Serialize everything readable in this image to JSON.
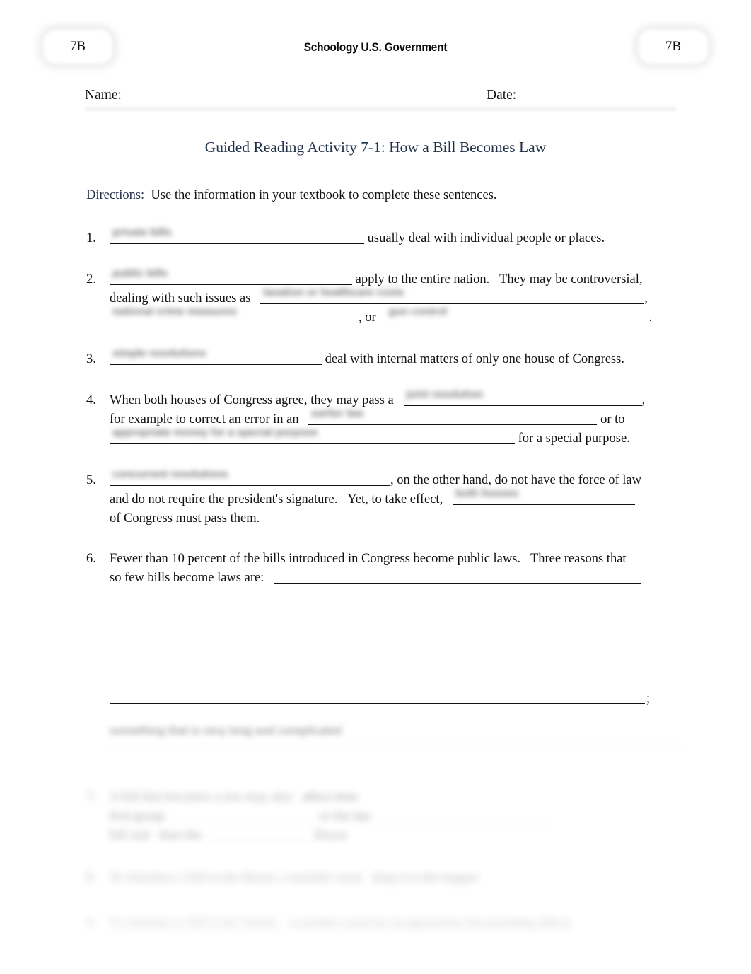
{
  "header": {
    "badge_left": "7B",
    "badge_right": "7B",
    "title": "Schoology U.S. Government"
  },
  "namedate": {
    "name_label": "Name:",
    "date_label": "Date:"
  },
  "document": {
    "title": "Guided Reading Activity 7-1: How a Bill Becomes Law",
    "directions_label": "Directions:",
    "directions_text": "Use the information in your textbook to complete these sentences."
  },
  "items": [
    {
      "number": "1.",
      "answer": "private bills",
      "text_after": "usually deal with individual people or places."
    },
    {
      "number": "2.",
      "answer": "public bills",
      "text_after": "apply to the entire nation.",
      "text_after2": "They may be controversial,",
      "line2_before": "dealing with such issues as",
      "line2_answer": "taxation or healthcare costs",
      "line3_answer": "national crime measures",
      "line3_mid": ", or",
      "line3_answer2": "gun control"
    },
    {
      "number": "3.",
      "answer": "simple resolutions",
      "text_after": "deal with internal matters of only one house of Congress."
    },
    {
      "number": "4.",
      "number_line1": "When both houses of Congress agree, they may pass a",
      "answer": "joint resolution",
      "line2_before": "for example to correct an error in an",
      "line2_answer": "earlier law",
      "line2_after": "or to",
      "line3_answer": "appropriate money for a special purpose",
      "line3_after": "for a special purpose."
    },
    {
      "number": "5.",
      "answer": "concurrent resolutions",
      "text_after": ", on the other hand, do not have the force of law",
      "line2": "and do not require the president's signature.",
      "line2b": "Yet, to take effect,",
      "line2_answer": "both houses",
      "line3": "of Congress must pass them."
    },
    {
      "number": "6.",
      "line1": "Fewer than 10 percent of the bills introduced in Congress become public laws.",
      "line1b": "Three reasons that",
      "line2": "so few bills become laws are:"
    }
  ],
  "tail": {
    "semicolon": ";",
    "faded_line_1": "something that is very long and complicated",
    "faded_items": [
      {
        "number": "7.",
        "text": "A bill that becomes a law may also",
        "answer": "affect their",
        "line2a": "first group",
        "line2b": "or the law",
        "line3a": "bill and",
        "line3b": "then the",
        "line3c": "House"
      },
      {
        "number": "8.",
        "text": "To introduce a bill in the House, a member must",
        "answer": "drop it in the hopper"
      },
      {
        "number": "9.",
        "text": "To introduce a bill in the Senate,",
        "answer": "a member must be recognized by the presiding officer"
      }
    ]
  },
  "colors": {
    "title_navy": "#1f3048",
    "body_text": "#111111",
    "page_bg": "#ffffff"
  }
}
